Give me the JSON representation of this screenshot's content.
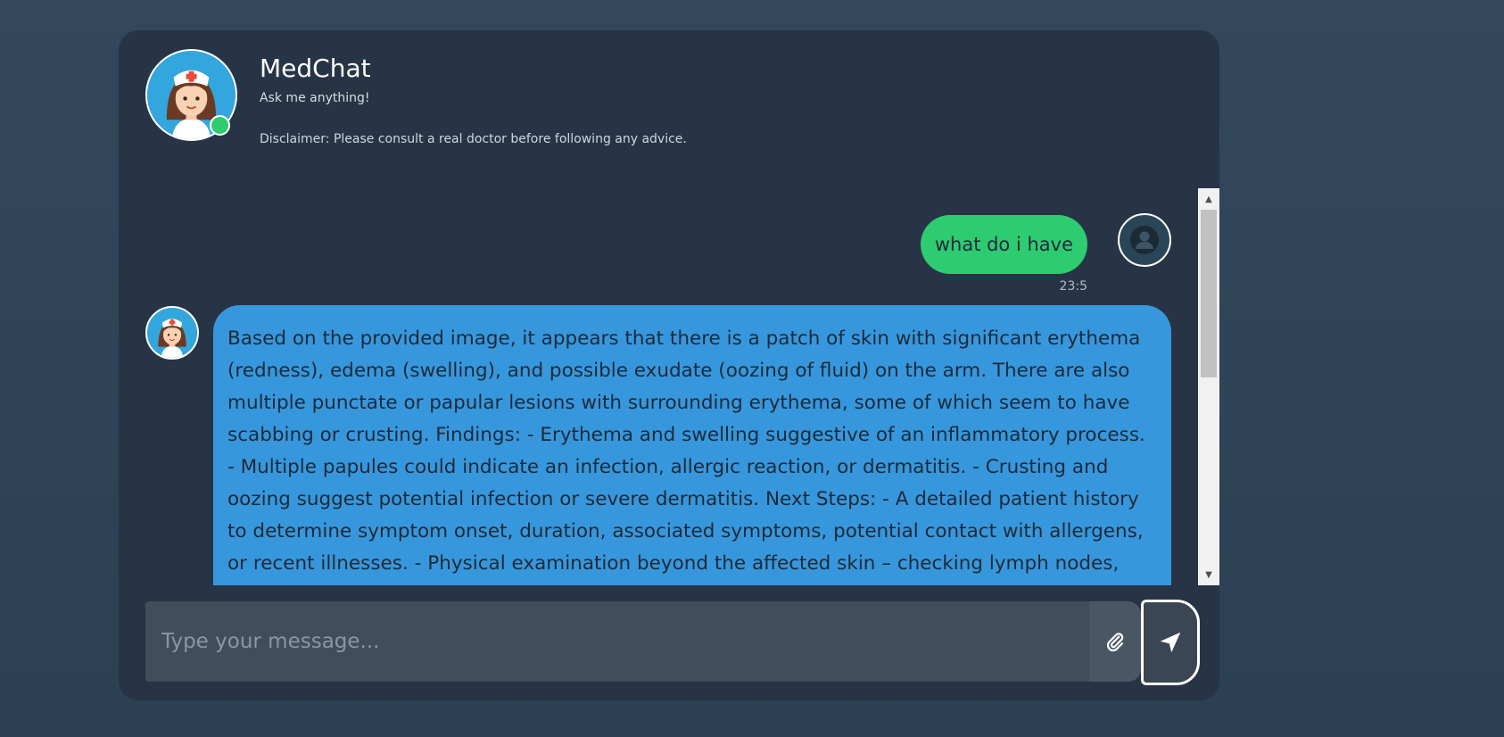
{
  "header": {
    "title": "MedChat",
    "subtitle": "Ask me anything!",
    "disclaimer": "Disclaimer: Please consult a real doctor before following any advice."
  },
  "messages": {
    "user": {
      "text": "what do i have",
      "timestamp": "23:5"
    },
    "bot": {
      "text": "Based on the provided image, it appears that there is a patch of skin with significant erythema (redness), edema (swelling), and possible exudate (oozing of fluid) on the arm. There are also multiple punctate or papular lesions with surrounding erythema, some of which seem to have scabbing or crusting. Findings: - Erythema and swelling suggestive of an inflammatory process. - Multiple papules could indicate an infection, allergic reaction, or dermatitis. - Crusting and oozing suggest potential infection or severe dermatitis. Next Steps: - A detailed patient history to determine symptom onset, duration, associated symptoms, potential contact with allergens, or recent illnesses. - Physical examination beyond the affected skin – checking lymph nodes,"
    }
  },
  "composer": {
    "placeholder": "Type your message..."
  },
  "icons": {
    "attach": "paperclip-icon",
    "send": "send-arrow-icon",
    "user_avatar": "user-icon",
    "scroll_up": "scroll-up-arrow-icon",
    "scroll_down": "scroll-down-arrow-icon"
  },
  "colors": {
    "user_bubble": "#2ecc71",
    "bot_bubble": "#3797dd",
    "online": "#2ecc71",
    "card": "#263445"
  }
}
